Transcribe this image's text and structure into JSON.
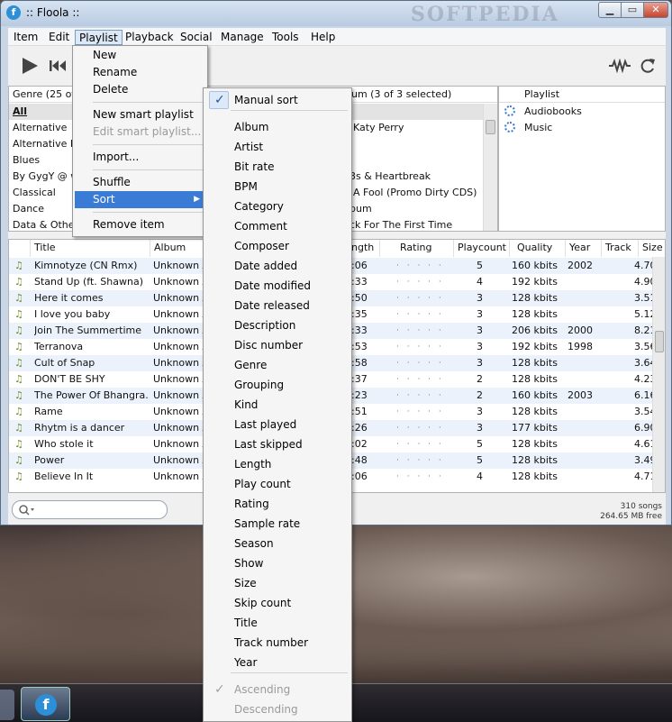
{
  "window": {
    "title": ":: Floola ::",
    "watermark": "SOFTPEDIA"
  },
  "menubar": [
    "Item",
    "Edit",
    "Playlist",
    "Playback",
    "Social",
    "Manage",
    "Tools",
    "Help"
  ],
  "genre_pane": {
    "header": "Genre (25 of",
    "items": [
      "All",
      "Alternative",
      "Alternative El",
      "Blues",
      "By GygY @ w",
      "Classical",
      "Dance",
      "Data & Other"
    ]
  },
  "album_pane": {
    "header": "um (3 of 3 selected)",
    "items": [
      "",
      "Katy Perry",
      "",
      "",
      "3s & Heartbreak",
      "A Fool (Promo Dirty CDS)",
      "bum",
      "ck For The First Time"
    ]
  },
  "playlist_pane": {
    "header": "Playlist",
    "items": [
      "Audiobooks",
      "Music"
    ]
  },
  "columns": {
    "title": "Title",
    "album": "Album",
    "length": "ngth",
    "rating": "Rating",
    "playcount": "Playcount",
    "quality": "Quality",
    "year": "Year",
    "track": "Track",
    "size": "Size"
  },
  "tracks": [
    {
      "title": "Kimnotyze (CN Rmx)",
      "album": "Unknown A",
      "length": ":06",
      "playcount": "5",
      "quality": "160 kbits",
      "year": "2002",
      "size": "4.70"
    },
    {
      "title": "Stand Up (ft. Shawna)",
      "album": "Unknown A",
      "length": ":33",
      "playcount": "4",
      "quality": "192 kbits",
      "year": "",
      "size": "4.90"
    },
    {
      "title": "Here it comes",
      "album": "Unknown A",
      "length": ":50",
      "playcount": "3",
      "quality": "128 kbits",
      "year": "",
      "size": "3.51"
    },
    {
      "title": "I love you baby",
      "album": "Unknown A",
      "length": ":35",
      "playcount": "3",
      "quality": "128 kbits",
      "year": "",
      "size": "5.12"
    },
    {
      "title": "Join The Summertime",
      "album": "Unknown A",
      "length": ":33",
      "playcount": "3",
      "quality": "206 kbits",
      "year": "2000",
      "size": "8.21"
    },
    {
      "title": "Terranova",
      "album": "Unknown A",
      "length": ":53",
      "playcount": "3",
      "quality": "192 kbits",
      "year": "1998",
      "size": "3.56"
    },
    {
      "title": "Cult of Snap",
      "album": "Unknown A",
      "length": ":58",
      "playcount": "3",
      "quality": "128 kbits",
      "year": "",
      "size": "3.64"
    },
    {
      "title": "DON'T BE SHY",
      "album": "Unknown A",
      "length": ":37",
      "playcount": "2",
      "quality": "128 kbits",
      "year": "",
      "size": "4.23"
    },
    {
      "title": "The Power Of Bhangra...",
      "album": "Unknown A",
      "length": ":23",
      "playcount": "2",
      "quality": "160 kbits",
      "year": "2003",
      "size": "6.16"
    },
    {
      "title": "Rame",
      "album": "Unknown A",
      "length": ":51",
      "playcount": "3",
      "quality": "128 kbits",
      "year": "",
      "size": "3.54"
    },
    {
      "title": "Rhytm is a dancer",
      "album": "Unknown A",
      "length": ":26",
      "playcount": "3",
      "quality": "177 kbits",
      "year": "",
      "size": "6.90"
    },
    {
      "title": "Who stole it",
      "album": "Unknown A",
      "length": ":02",
      "playcount": "5",
      "quality": "128 kbits",
      "year": "",
      "size": "4.61"
    },
    {
      "title": "Power",
      "album": "Unknown A",
      "length": ":48",
      "playcount": "5",
      "quality": "128 kbits",
      "year": "",
      "size": "3.49"
    },
    {
      "title": "Believe In It",
      "album": "Unknown A",
      "length": ":06",
      "playcount": "4",
      "quality": "128 kbits",
      "year": "",
      "size": "4.71"
    }
  ],
  "rating_dots": "· · · · ·",
  "status": {
    "songs": "310 songs",
    "free": "264.65 MB free"
  },
  "playlist_menu": {
    "items": [
      "New",
      "Rename",
      "Delete",
      "New smart playlist",
      "Edit smart playlist...",
      "Import...",
      "Shuffle",
      "Sort",
      "Remove item"
    ]
  },
  "sort_menu": {
    "check": "✓",
    "items": [
      "Manual sort",
      "Album",
      "Artist",
      "Bit rate",
      "BPM",
      "Category",
      "Comment",
      "Composer",
      "Date added",
      "Date modified",
      "Date released",
      "Description",
      "Disc number",
      "Genre",
      "Grouping",
      "Kind",
      "Last played",
      "Last skipped",
      "Length",
      "Play count",
      "Rating",
      "Sample rate",
      "Season",
      "Show",
      "Size",
      "Skip count",
      "Title",
      "Track number",
      "Year",
      "Ascending",
      "Descending"
    ]
  },
  "icons": {
    "play": "play-icon",
    "rewind": "rewind-icon",
    "waveform": "waveform-icon",
    "refresh": "refresh-icon",
    "search": "search-icon",
    "music_note": "music-note-icon",
    "gear": "gear-icon",
    "app": "floola-icon"
  },
  "colors": {
    "menu_highlight": "#3a7bd5",
    "row_alt": "#ecf2fb",
    "note": "#6a8f2a",
    "playlist_icon": "#3b79c5"
  }
}
